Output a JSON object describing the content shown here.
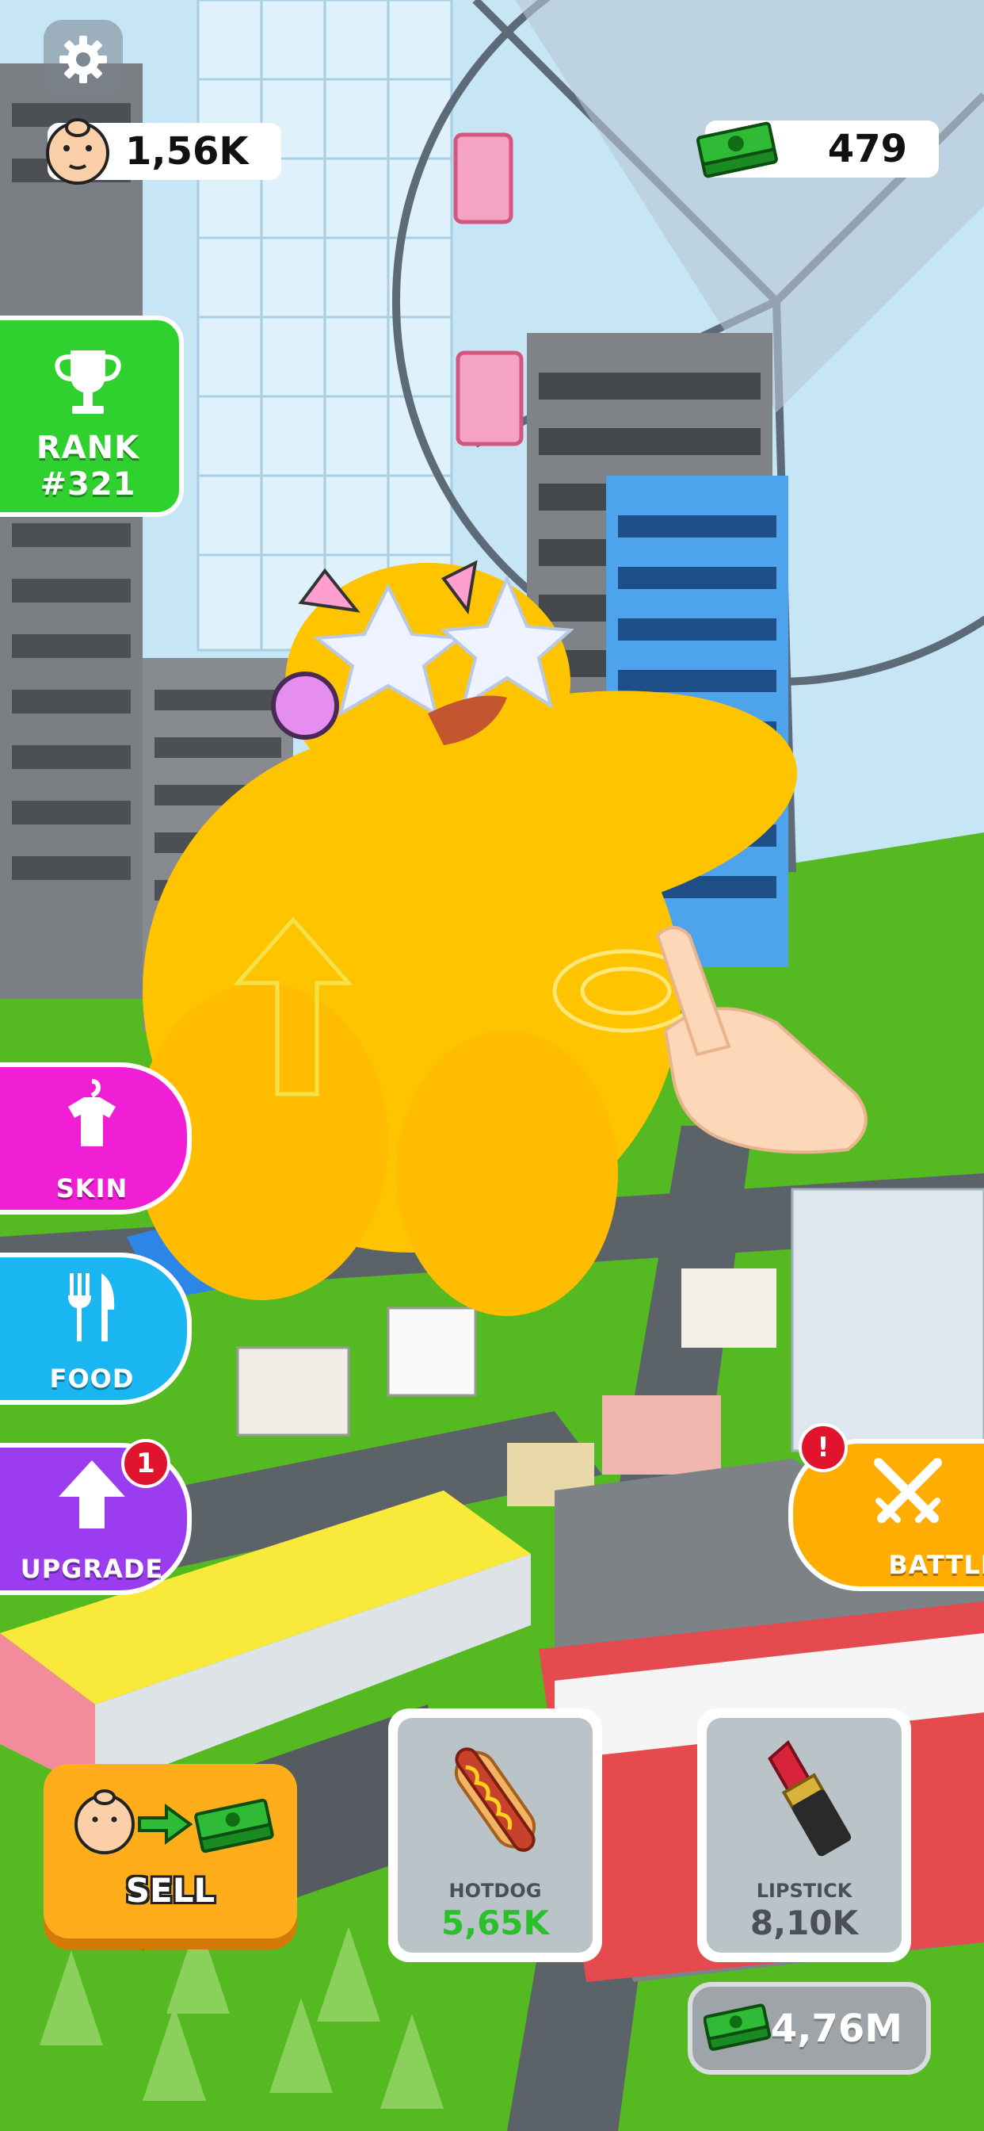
{
  "hud": {
    "followers_value": "1,56K",
    "cash_value": "479",
    "icons": {
      "settings": "gear-icon",
      "followers": "sumo-face-icon",
      "cash": "cash-stack-icon"
    }
  },
  "side_menu": {
    "rank": {
      "label": "RANK",
      "value": "#321",
      "icon": "trophy-icon",
      "color": "#2fd12f"
    },
    "skin": {
      "label": "SKIN",
      "icon": "shirt-hanger-icon",
      "color": "#f01fd6"
    },
    "food": {
      "label": "FOOD",
      "icon": "fork-knife-icon",
      "color": "#19b6f2"
    },
    "upgrade": {
      "label": "UPGRADE",
      "icon": "arrow-up-icon",
      "badge": "1",
      "color": "#9b3cf0"
    }
  },
  "battle": {
    "label": "BATTLE",
    "icon": "crossed-swords-icon",
    "badge": "!",
    "color": "#ffad00"
  },
  "sell": {
    "label": "SELL",
    "icon": "sumo-to-cash-icon",
    "color": "#ffad1a"
  },
  "shop": {
    "items": [
      {
        "name": "HOTDOG",
        "price": "5,65K",
        "icon": "hotdog-icon",
        "price_color": "#2bbf2b"
      },
      {
        "name": "LIPSTICK",
        "price": "8,10K",
        "icon": "lipstick-icon",
        "price_color": "#4a5055"
      }
    ]
  },
  "total_cash": {
    "value": "4,76M",
    "icon": "cash-stack-icon"
  },
  "colors": {
    "character": "#ffc400",
    "grass": "#4fb81e",
    "road": "#5b6369"
  }
}
